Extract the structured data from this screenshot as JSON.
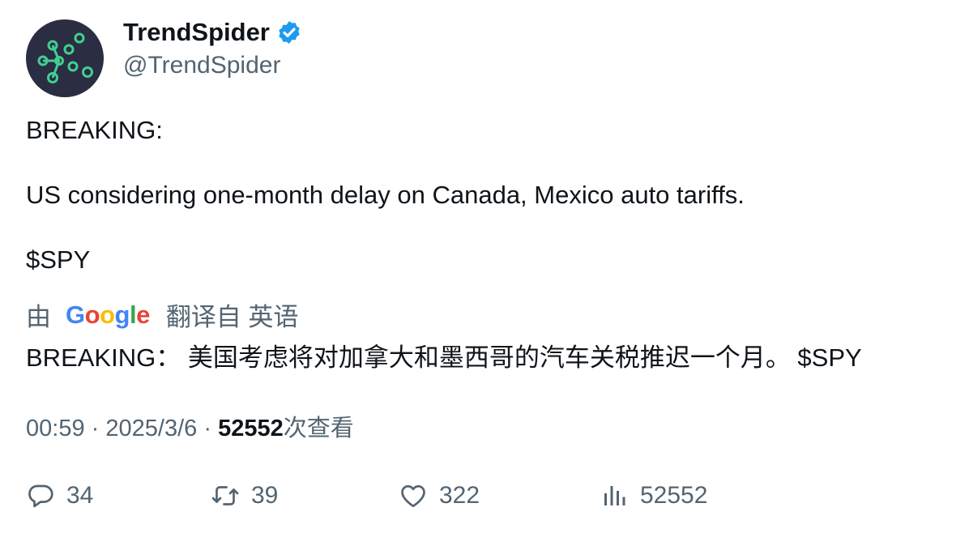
{
  "author": {
    "display_name": "TrendSpider",
    "handle": "@TrendSpider",
    "verified_icon": "verified-badge-icon",
    "avatar_icon": "trendspider-logo-icon"
  },
  "tweet": {
    "line1": "BREAKING:",
    "line2": "US considering one-month delay on Canada, Mexico auto tariffs.",
    "line3": "$SPY"
  },
  "translation": {
    "prefix": "由",
    "provider": "Google",
    "label": "翻译自 英语",
    "text": "BREAKING： 美国考虑将对加拿大和墨西哥的汽车关税推迟一个月。 $SPY"
  },
  "meta": {
    "time": "00:59",
    "separator": "·",
    "date": "2025/3/6",
    "views": "52552",
    "views_suffix": "次查看"
  },
  "actions": {
    "replies": "34",
    "retweets": "39",
    "likes": "322",
    "views": "52552"
  },
  "colors": {
    "text_primary": "#0f1419",
    "text_secondary": "#536471",
    "verified": "#1d9bf0",
    "avatar_bg": "#2b2d42",
    "avatar_nodes": "#3fd08f"
  }
}
